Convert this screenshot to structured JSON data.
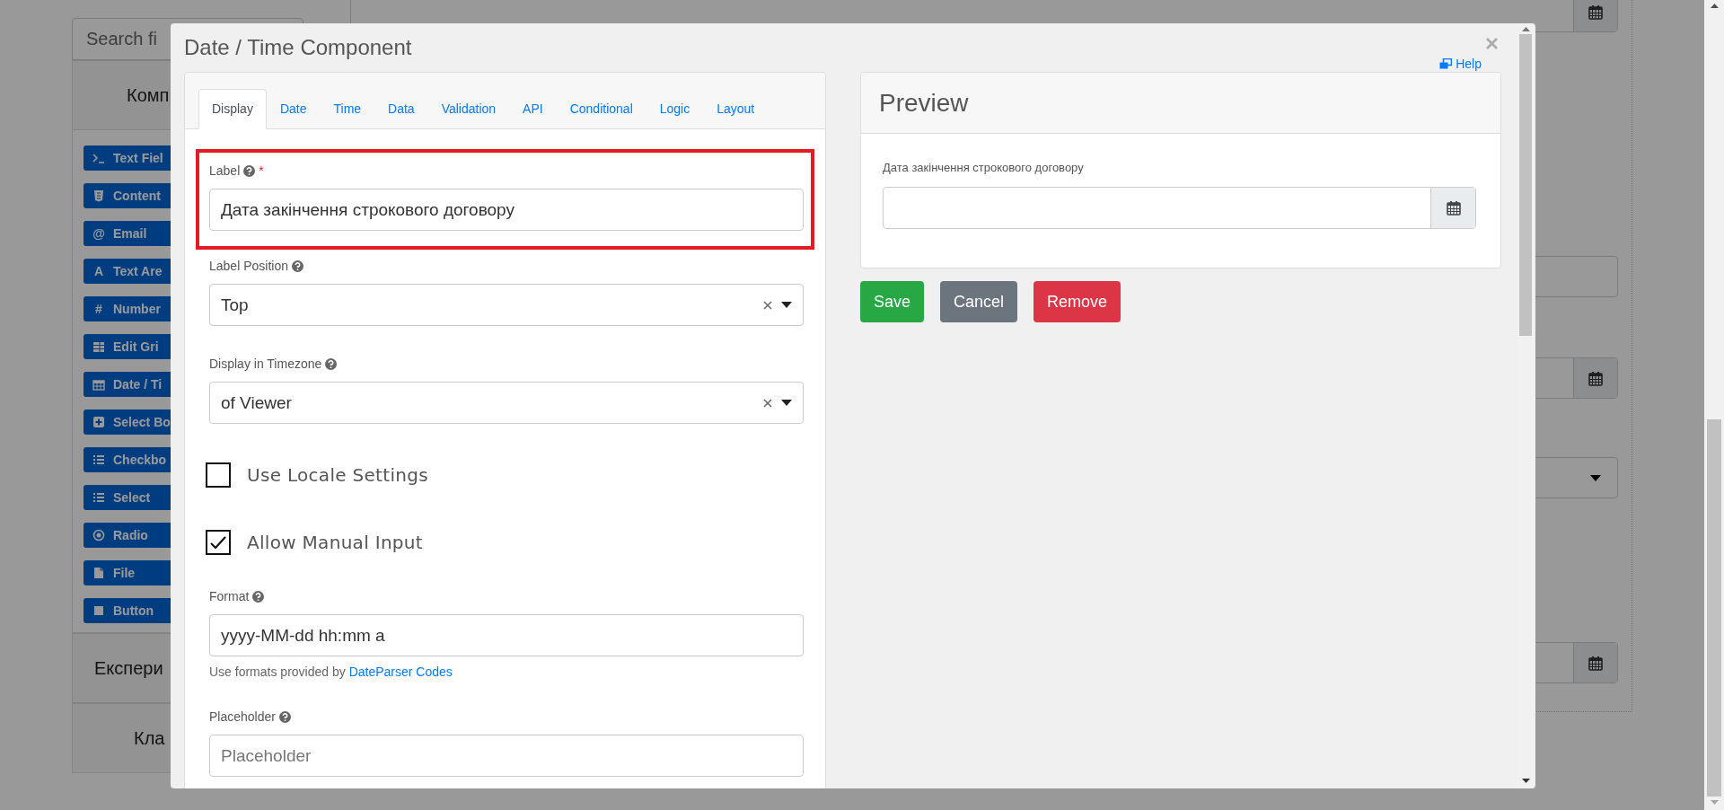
{
  "page": {
    "sidebar": {
      "search_placeholder": "Search fi",
      "groups": [
        {
          "title": "Комп",
          "items": [
            {
              "label": "Text Fiel"
            },
            {
              "label": "Content"
            },
            {
              "label": "Email",
              "glyph": "@"
            },
            {
              "label": "Text Are",
              "glyph": "A"
            },
            {
              "label": "Number",
              "glyph": "#"
            },
            {
              "label": "Edit Gri"
            },
            {
              "label": "Date / Ti"
            },
            {
              "label": "Select Bo"
            },
            {
              "label": "Checkbo"
            },
            {
              "label": "Select"
            },
            {
              "label": "Radio"
            },
            {
              "label": "File"
            },
            {
              "label": "Button"
            }
          ]
        },
        {
          "title": "Експери"
        },
        {
          "title": "Кла"
        }
      ]
    },
    "form_fields": [
      {
        "kind": "date"
      },
      {
        "kind": "text"
      },
      {
        "kind": "date"
      },
      {
        "kind": "select"
      },
      {
        "kind": "date"
      }
    ]
  },
  "modal": {
    "title": "Date / Time Component",
    "help_link": "Help",
    "tabs": [
      {
        "label": "Display",
        "selected": true
      },
      {
        "label": "Date",
        "selected": false
      },
      {
        "label": "Time",
        "selected": false
      },
      {
        "label": "Data",
        "selected": false
      },
      {
        "label": "Validation",
        "selected": false
      },
      {
        "label": "API",
        "selected": false
      },
      {
        "label": "Conditional",
        "selected": false
      },
      {
        "label": "Logic",
        "selected": false
      },
      {
        "label": "Layout",
        "selected": false
      }
    ],
    "fields": [
      {
        "kind": "text",
        "label": "Label",
        "help": true,
        "required_mark": "*",
        "value": "Дата закінчення строкового договору",
        "highlighted": true
      },
      {
        "kind": "select",
        "label": "Label Position",
        "help": true,
        "value": "Top",
        "highlighted": false
      },
      {
        "kind": "select",
        "label": "Display in Timezone",
        "help": true,
        "value": "of Viewer",
        "highlighted": false
      },
      {
        "kind": "checkbox",
        "label": "Use Locale Settings",
        "checked": false,
        "highlighted": false
      },
      {
        "kind": "checkbox",
        "label": "Allow Manual Input",
        "checked": true,
        "highlighted": false
      },
      {
        "kind": "text",
        "label": "Format",
        "help": true,
        "value": "yyyy-MM-dd hh:mm a",
        "description": "Use formats provided by ",
        "description_link": "DateParser Codes",
        "highlighted": false
      },
      {
        "kind": "text",
        "label": "Placeholder",
        "help": true,
        "placeholder": "Placeholder",
        "highlighted": false
      }
    ],
    "preview": {
      "title": "Preview",
      "field_label": "Дата закінчення строкового договору"
    },
    "buttons": [
      {
        "label": "Save",
        "kind": "success"
      },
      {
        "label": "Cancel",
        "kind": "secondary"
      },
      {
        "label": "Remove",
        "kind": "danger"
      }
    ]
  }
}
